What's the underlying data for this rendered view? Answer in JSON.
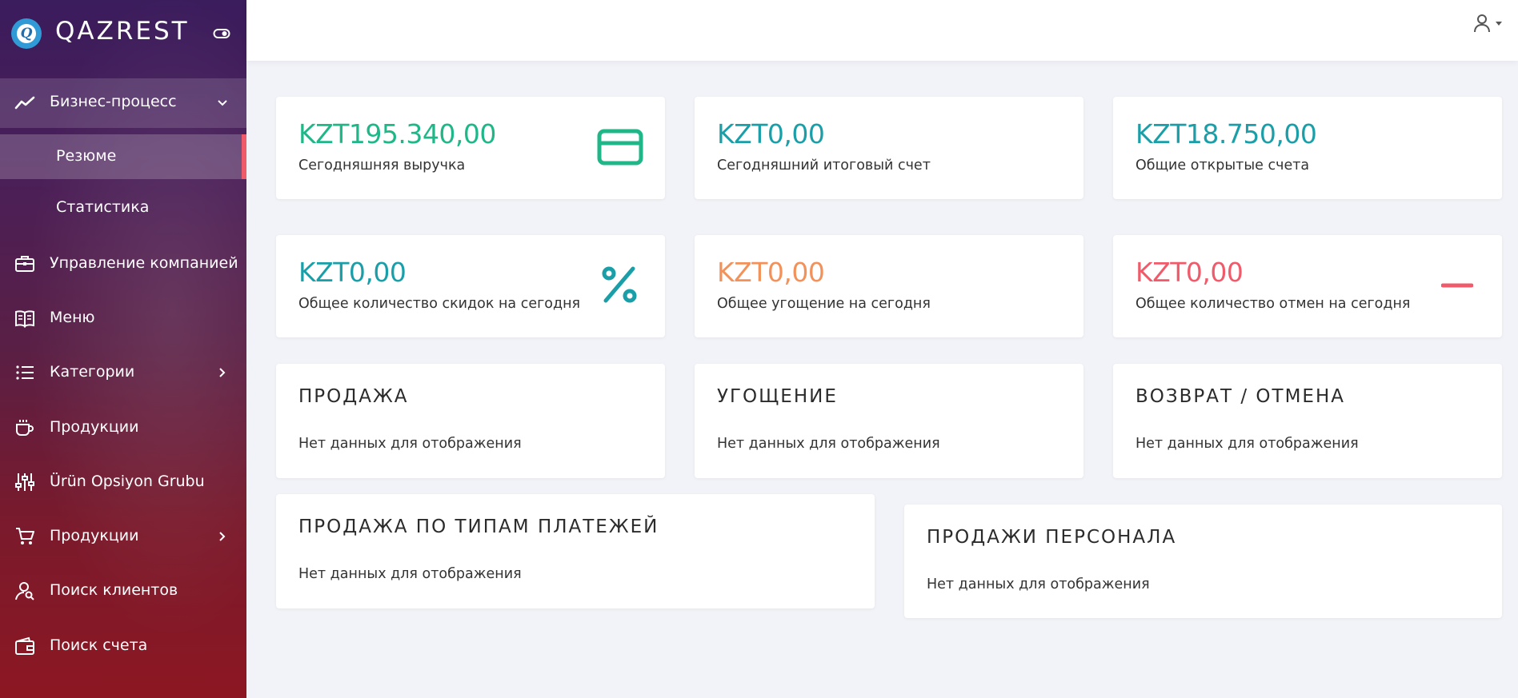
{
  "brand": {
    "title": "QAZREST",
    "logo_letter": "Q"
  },
  "sidebar": {
    "items": [
      {
        "label": "Бизнес-процесс",
        "icon": "trending-up-icon",
        "expanded": true
      },
      {
        "label": "Резюме",
        "sub": true,
        "active": true
      },
      {
        "label": "Статистика",
        "sub": true
      },
      {
        "label": "Управление компанией",
        "icon": "briefcase-icon"
      },
      {
        "label": "Меню",
        "icon": "book-icon"
      },
      {
        "label": "Категории",
        "icon": "list-icon",
        "has_children": true
      },
      {
        "label": "Продукции",
        "icon": "coffee-cup-icon"
      },
      {
        "label": "Ürün Opsiyon Grubu",
        "icon": "sliders-icon"
      },
      {
        "label": "Продукции",
        "icon": "cart-icon",
        "has_children": true
      },
      {
        "label": "Поиск клиентов",
        "icon": "user-search-icon"
      },
      {
        "label": "Поиск счета",
        "icon": "wallet-icon"
      }
    ]
  },
  "stats": [
    {
      "value": "KZT195.340,00",
      "label": "Сегодняшняя выручка",
      "color": "#1fb788",
      "icon": "credit-card-icon"
    },
    {
      "value": "KZT0,00",
      "label": "Сегодняшний итоговый счет",
      "color": "#1a9fa9"
    },
    {
      "value": "KZT18.750,00",
      "label": "Общие открытые счета",
      "color": "#1a9fa9"
    },
    {
      "value": "KZT0,00",
      "label": "Общее количество скидок на сегодня",
      "color": "#1a9fa9",
      "icon": "percent-icon"
    },
    {
      "value": "KZT0,00",
      "label": "Общее угощение на сегодня",
      "color": "#f2925a"
    },
    {
      "value": "KZT0,00",
      "label": "Общее количество отмен на сегодня",
      "color": "#ef5b6a",
      "icon": "minus-icon"
    }
  ],
  "sections": [
    {
      "title": "ПРОДАЖА",
      "empty": "Нет данных для отображения"
    },
    {
      "title": "УГОЩЕНИЕ",
      "empty": "Нет данных для отображения"
    },
    {
      "title": "ВОЗВРАТ / ОТМЕНА",
      "empty": "Нет данных для отображения"
    },
    {
      "title": "ПРОДАЖА ПО ТИПАМ ПЛАТЕЖЕЙ",
      "empty": "Нет данных для отображения"
    },
    {
      "title": "ПРОДАЖИ ПЕРСОНАЛА",
      "empty": "Нет данных для отображения"
    }
  ]
}
